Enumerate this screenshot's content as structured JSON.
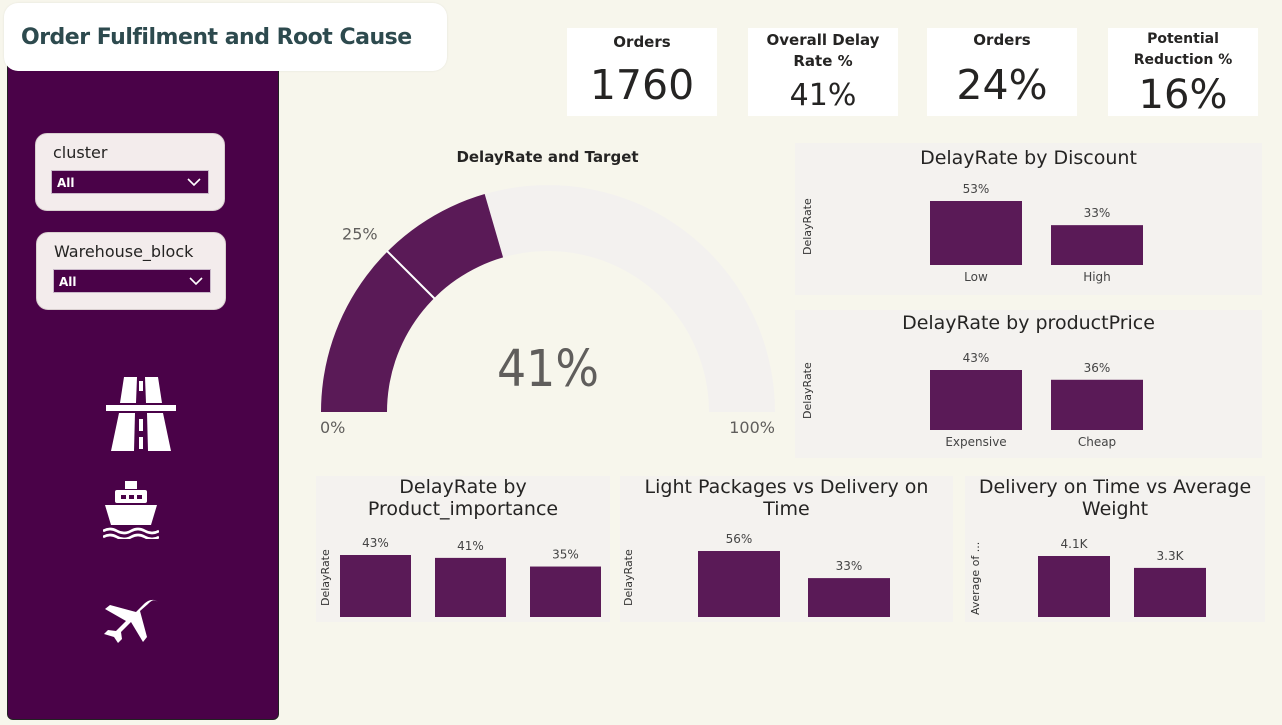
{
  "header": {
    "title": "Order Fulfilment and Root Cause"
  },
  "filters": {
    "cluster": {
      "label": "cluster",
      "value": "All"
    },
    "warehouse": {
      "label": "Warehouse_block",
      "value": "All"
    }
  },
  "sidebar_icons": [
    "highway-icon",
    "ship-icon",
    "airplane-icon"
  ],
  "kpis": [
    {
      "label": "Orders",
      "value": "1760"
    },
    {
      "label": "Overall Delay Rate %",
      "value": "41%"
    },
    {
      "label": "Orders",
      "value": "24%"
    },
    {
      "label": "Potential Reduction %",
      "value": "16%"
    }
  ],
  "colors": {
    "bar": "#5a1a57",
    "sidebar": "#4a0248",
    "gauge_track": "#f3f1ef"
  },
  "chart_data": [
    {
      "type": "gauge",
      "title": "DelayRate and Target",
      "value": 41,
      "value_label": "41%",
      "min": 0,
      "max": 100,
      "min_label": "0%",
      "max_label": "100%",
      "target": 25,
      "target_label": "25%"
    },
    {
      "type": "bar",
      "title": "DelayRate by Discount",
      "ylabel": "DelayRate",
      "categories": [
        "Low",
        "High"
      ],
      "values": [
        53,
        33
      ],
      "labels": [
        "53%",
        "33%"
      ]
    },
    {
      "type": "bar",
      "title": "DelayRate by productPrice",
      "ylabel": "DelayRate",
      "categories": [
        "Expensive",
        "Cheap"
      ],
      "values": [
        43,
        36
      ],
      "labels": [
        "43%",
        "36%"
      ]
    },
    {
      "type": "bar",
      "title": "DelayRate by Product_importance",
      "ylabel": "DelayRate",
      "categories": [],
      "values": [
        43,
        41,
        35
      ],
      "labels": [
        "43%",
        "41%",
        "35%"
      ]
    },
    {
      "type": "bar",
      "title": "Light Packages vs Delivery on Time",
      "ylabel": "DelayRate",
      "categories": [],
      "values": [
        56,
        33
      ],
      "labels": [
        "56%",
        "33%"
      ]
    },
    {
      "type": "bar",
      "title": "Delivery on Time vs Average Weight",
      "ylabel": "Average of ...",
      "categories": [],
      "values": [
        4.1,
        3.3
      ],
      "labels": [
        "4.1K",
        "3.3K"
      ]
    }
  ]
}
